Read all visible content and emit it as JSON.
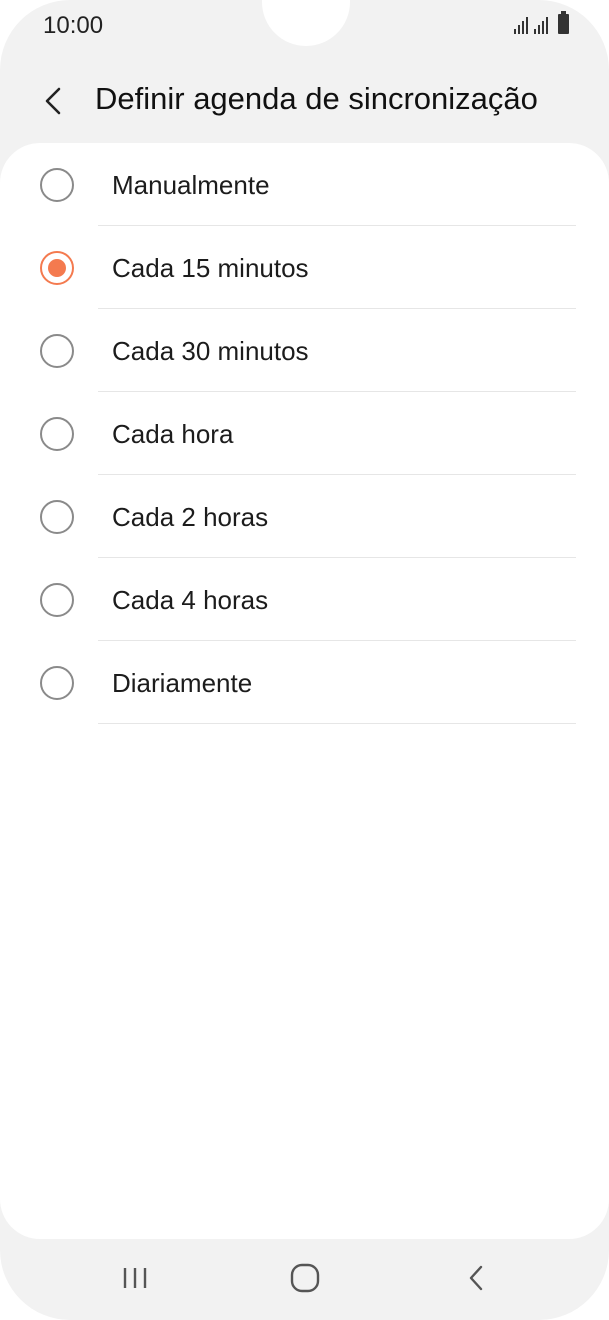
{
  "status_bar": {
    "time": "10:00",
    "icons": [
      "signal-icon",
      "signal-icon",
      "battery-icon"
    ]
  },
  "header": {
    "title": "Definir agenda de sincronização",
    "back_icon": "chevron-left-icon"
  },
  "options": [
    {
      "label": "Manualmente",
      "selected": false
    },
    {
      "label": "Cada 15 minutos",
      "selected": true
    },
    {
      "label": "Cada 30 minutos",
      "selected": false
    },
    {
      "label": "Cada hora",
      "selected": false
    },
    {
      "label": "Cada 2 horas",
      "selected": false
    },
    {
      "label": "Cada 4 horas",
      "selected": false
    },
    {
      "label": "Diariamente",
      "selected": false
    }
  ],
  "nav_bar": {
    "icons": [
      "recent-apps-icon",
      "home-icon",
      "back-icon"
    ]
  },
  "colors": {
    "accent": "#f47a4f",
    "background": "#f2f2f2",
    "card": "#ffffff"
  }
}
